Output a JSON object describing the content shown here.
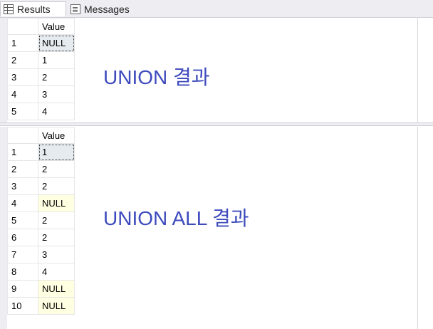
{
  "tabs": [
    {
      "label": "Results",
      "icon": "grid-icon"
    },
    {
      "label": "Messages",
      "icon": "message-icon"
    }
  ],
  "result1": {
    "column": "Value",
    "caption": "UNION 결과",
    "rows": [
      {
        "n": "1",
        "v": "NULL"
      },
      {
        "n": "2",
        "v": "1"
      },
      {
        "n": "3",
        "v": "2"
      },
      {
        "n": "4",
        "v": "3"
      },
      {
        "n": "5",
        "v": "4"
      }
    ]
  },
  "result2": {
    "column": "Value",
    "caption": "UNION ALL 결과",
    "rows": [
      {
        "n": "1",
        "v": "1"
      },
      {
        "n": "2",
        "v": "2"
      },
      {
        "n": "3",
        "v": "2"
      },
      {
        "n": "4",
        "v": "NULL"
      },
      {
        "n": "5",
        "v": "2"
      },
      {
        "n": "6",
        "v": "2"
      },
      {
        "n": "7",
        "v": "3"
      },
      {
        "n": "8",
        "v": "4"
      },
      {
        "n": "9",
        "v": "NULL"
      },
      {
        "n": "10",
        "v": "NULL"
      }
    ]
  },
  "colors": {
    "caption": "#3e4bbd",
    "null_cell": "#ffffe1",
    "selected_cell": "#e6ebf0"
  }
}
